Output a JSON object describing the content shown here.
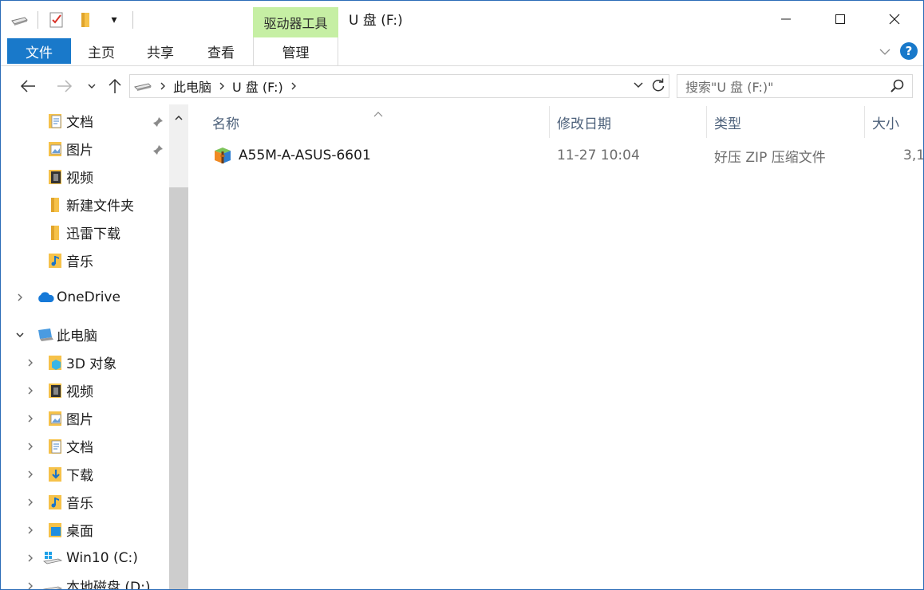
{
  "titlebar": {
    "context_tab_title": "驱动器工具",
    "window_title": "U 盘 (F:)",
    "qat_dropdown_glyph": "▾"
  },
  "ribbon": {
    "tabs": [
      {
        "label": "文件",
        "active": true
      },
      {
        "label": "主页"
      },
      {
        "label": "共享"
      },
      {
        "label": "查看"
      },
      {
        "label": "管理"
      }
    ],
    "help_label": "?"
  },
  "address": {
    "breadcrumbs": [
      "此电脑",
      "U 盘 (F:)"
    ],
    "search_placeholder": "搜索\"U 盘 (F:)\""
  },
  "nav_pane": {
    "quick_access": [
      {
        "label": "文档",
        "icon": "documents-icon",
        "pinned": true
      },
      {
        "label": "图片",
        "icon": "pictures-icon",
        "pinned": true
      },
      {
        "label": "视频",
        "icon": "videos-icon"
      },
      {
        "label": "新建文件夹",
        "icon": "folder-icon"
      },
      {
        "label": "迅雷下载",
        "icon": "folder-icon"
      },
      {
        "label": "音乐",
        "icon": "music-icon"
      }
    ],
    "onedrive": {
      "label": "OneDrive",
      "icon": "onedrive-cloud-icon"
    },
    "this_pc": {
      "label": "此电脑",
      "icon": "this-pc-icon"
    },
    "this_pc_children": [
      {
        "label": "3D 对象",
        "icon": "3d-objects-icon"
      },
      {
        "label": "视频",
        "icon": "videos-icon"
      },
      {
        "label": "图片",
        "icon": "pictures-icon"
      },
      {
        "label": "文档",
        "icon": "documents-icon"
      },
      {
        "label": "下载",
        "icon": "downloads-icon"
      },
      {
        "label": "音乐",
        "icon": "music-icon"
      },
      {
        "label": "桌面",
        "icon": "desktop-icon"
      },
      {
        "label": "Win10 (C:)",
        "icon": "windows-drive-icon"
      },
      {
        "label": "本地磁盘 (D:)",
        "icon": "drive-icon"
      }
    ]
  },
  "content": {
    "columns": [
      "名称",
      "修改日期",
      "类型",
      "大小"
    ],
    "rows": [
      {
        "name": "A55M-A-ASUS-6601",
        "date": "11-27 10:04",
        "type": "好压 ZIP 压缩文件",
        "size": "3,1",
        "icon": "zip-archive-icon"
      }
    ]
  },
  "colors": {
    "accent": "#1979ca",
    "context_tab": "#c6efa4",
    "header_text": "#4c607a",
    "window_border": "#2b6cb7"
  }
}
